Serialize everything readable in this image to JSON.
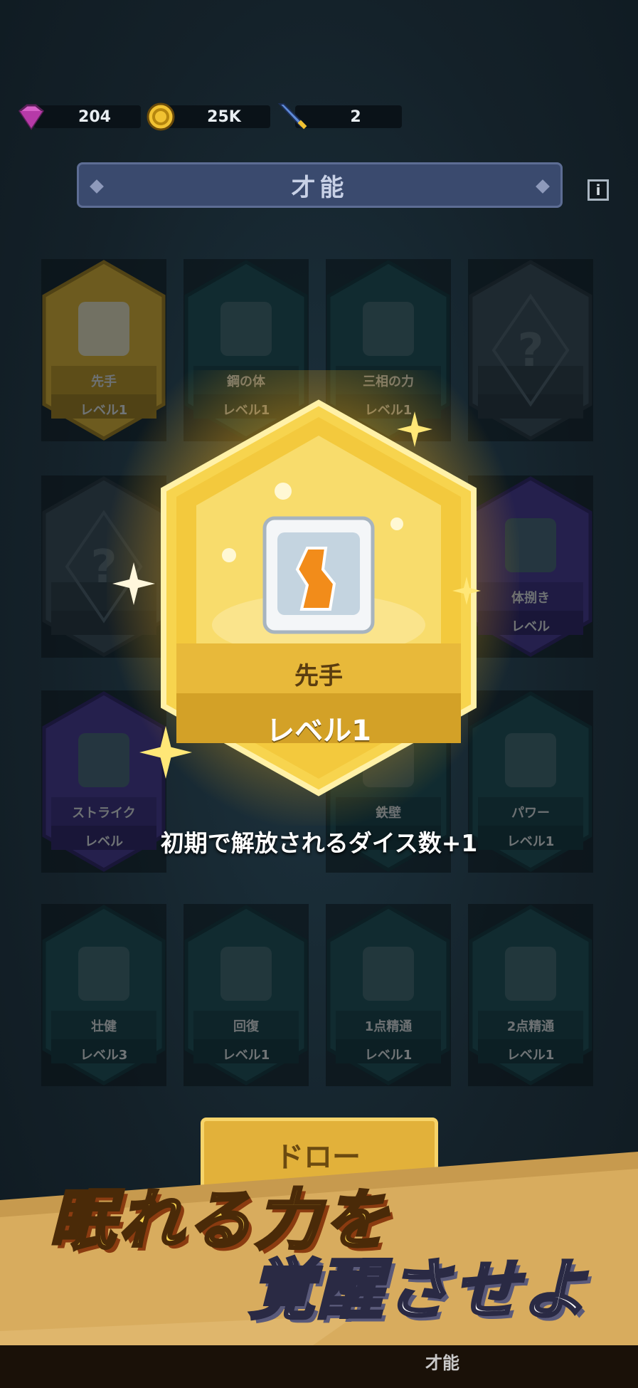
{
  "resources": {
    "gems": {
      "value": "204",
      "icon": "gem-icon"
    },
    "coins": {
      "value": "25K",
      "icon": "coin-icon"
    },
    "swords": {
      "value": "2",
      "icon": "sword-icon"
    }
  },
  "header": {
    "title": "才能",
    "info_label": "i"
  },
  "tiles": [
    {
      "name": "先手",
      "level": "レベル1"
    },
    {
      "name": "鋼の体",
      "level": "レベル1"
    },
    {
      "name": "三相の力",
      "level": "レベル1"
    },
    {
      "name": "",
      "level": "",
      "locked_icon": "question-mark-icon"
    },
    {
      "name": "",
      "level": "",
      "locked_icon": "question-mark-icon"
    },
    {
      "name": "体捌き",
      "level": "レベル"
    },
    {
      "name": "ストライク",
      "level": "レベル"
    },
    {
      "name": "鉄壁",
      "level": ""
    },
    {
      "name": "パワー",
      "level": "レベル1"
    },
    {
      "name": "壮健",
      "level": "レベル3"
    },
    {
      "name": "回復",
      "level": "レベル1"
    },
    {
      "name": "1点精通",
      "level": "レベル1"
    },
    {
      "name": "2点精通",
      "level": "レベル1"
    }
  ],
  "highlight": {
    "name": "先手",
    "level": "レベル1",
    "description": "初期で解放されるダイス数+1"
  },
  "draw_button": {
    "label": "ドロー"
  },
  "promo": {
    "line1": "眠れる力を",
    "line2": "覚醒させよ"
  },
  "bottom_nav": {
    "active_tab": "才能"
  },
  "colors": {
    "gold": "#f2c230",
    "teal": "#1f5a5a",
    "purple": "#5b3ea0",
    "bg": "#16232b"
  }
}
